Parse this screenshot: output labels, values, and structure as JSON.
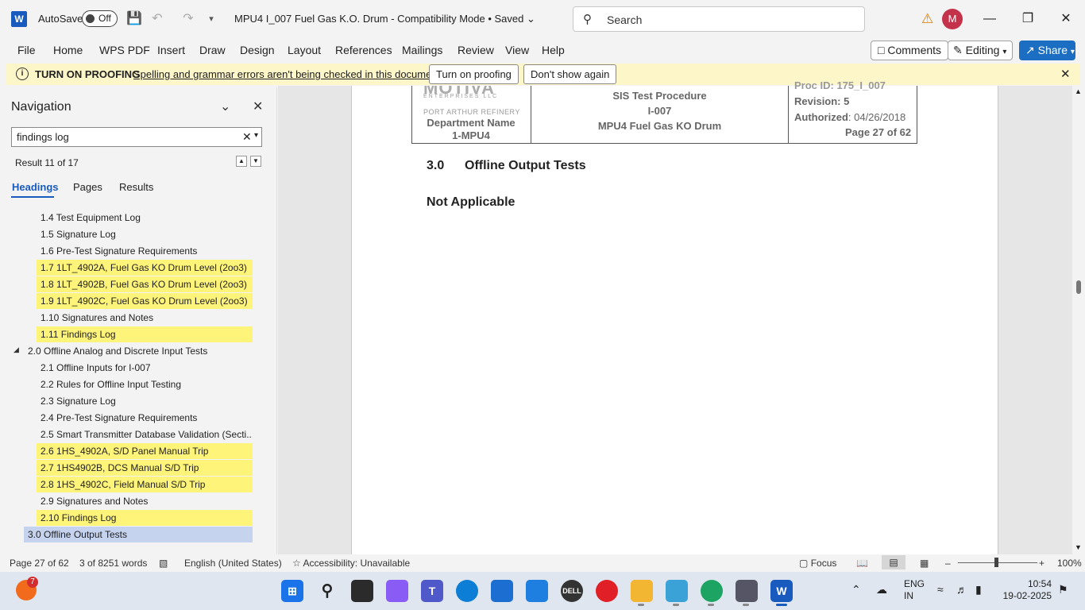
{
  "titlebar": {
    "autosave_label": "AutoSave",
    "autosave_state": "Off",
    "doc_title": "MPU4 I_007 Fuel Gas K.O. Drum  -  Compatibility Mode • Saved",
    "search_placeholder": "Search",
    "avatar_initial": "M"
  },
  "menu": {
    "file": "File",
    "home": "Home",
    "wps": "WPS PDF",
    "insert": "Insert",
    "draw": "Draw",
    "design": "Design",
    "layout": "Layout",
    "references": "References",
    "mailings": "Mailings",
    "review": "Review",
    "view": "View",
    "help": "Help",
    "comments": "Comments",
    "editing": "Editing",
    "share": "Share"
  },
  "proofing": {
    "title": "TURN ON PROOFING",
    "message": "Spelling and grammar errors aren't being checked in this document.",
    "turn_on": "Turn on proofing",
    "dont_show": "Don't show again"
  },
  "nav": {
    "title": "Navigation",
    "search_value": "findings log",
    "result_count": "Result 11 of 17",
    "tabs": [
      "Headings",
      "Pages",
      "Results"
    ],
    "headings": [
      {
        "label": "1.4 Test Equipment Log",
        "indent": 1,
        "hl": false
      },
      {
        "label": "1.5 Signature Log",
        "indent": 1,
        "hl": false
      },
      {
        "label": "1.6 Pre-Test Signature Requirements",
        "indent": 1,
        "hl": false
      },
      {
        "label": "1.7 1LT_4902A, Fuel Gas KO Drum Level (2oo3)",
        "indent": 1,
        "hl": true
      },
      {
        "label": "1.8 1LT_4902B, Fuel Gas KO Drum Level (2oo3)",
        "indent": 1,
        "hl": true
      },
      {
        "label": "1.9 1LT_4902C, Fuel Gas KO Drum Level (2oo3)",
        "indent": 1,
        "hl": true
      },
      {
        "label": "1.10 Signatures and Notes",
        "indent": 1,
        "hl": false
      },
      {
        "label": "1.11 Findings Log",
        "indent": 1,
        "hl": true
      },
      {
        "label": "2.0 Offline Analog and Discrete Input Tests",
        "indent": 0,
        "hl": false
      },
      {
        "label": "2.1 Offline Inputs for I-007",
        "indent": 1,
        "hl": false
      },
      {
        "label": "2.2 Rules for Offline Input Testing",
        "indent": 1,
        "hl": false
      },
      {
        "label": "2.3 Signature Log",
        "indent": 1,
        "hl": false
      },
      {
        "label": "2.4 Pre-Test Signature Requirements",
        "indent": 1,
        "hl": false
      },
      {
        "label": "2.5 Smart Transmitter Database Validation (Secti...",
        "indent": 1,
        "hl": false
      },
      {
        "label": "2.6 1HS_4902A, S/D Panel Manual Trip",
        "indent": 1,
        "hl": true
      },
      {
        "label": "2.7 1HS4902B, DCS Manual S/D Trip",
        "indent": 1,
        "hl": true
      },
      {
        "label": "2.8 1HS_4902C, Field Manual S/D Trip",
        "indent": 1,
        "hl": true
      },
      {
        "label": "2.9 Signatures and Notes",
        "indent": 1,
        "hl": false
      },
      {
        "label": "2.10 Findings Log",
        "indent": 1,
        "hl": true
      },
      {
        "label": "3.0 Offline Output Tests",
        "indent": 0,
        "hl": false,
        "selected": true
      }
    ]
  },
  "document": {
    "logo_text": "MOTIVA",
    "logo_sub": "ENTERPRISES LLC",
    "refinery": "PORT ARTHUR REFINERY",
    "dept_name": "Department Name",
    "dept_unit": "1-MPU4",
    "sis_title": "SIS Test Procedure",
    "sis_id": "I-007",
    "sis_subject": "MPU4 Fuel Gas KO Drum",
    "proc_id": "Proc ID: 175_I_007",
    "revision": "Revision: 5",
    "authorized_label": "Authorized",
    "authorized_date": ": 04/26/2018",
    "page_of": "Page 27 of 62",
    "section_number": "3.0",
    "section_title": "Offline Output Tests",
    "body": "Not Applicable"
  },
  "status": {
    "page": "Page 27 of 62",
    "words": "3 of 8251 words",
    "language": "English (United States)",
    "accessibility": "Accessibility: Unavailable",
    "focus": "Focus",
    "zoom": "100%"
  },
  "taskbar": {
    "badge": "7",
    "lang_top": "ENG",
    "lang_bottom": "IN",
    "time": "10:54",
    "date": "19-02-2025"
  }
}
